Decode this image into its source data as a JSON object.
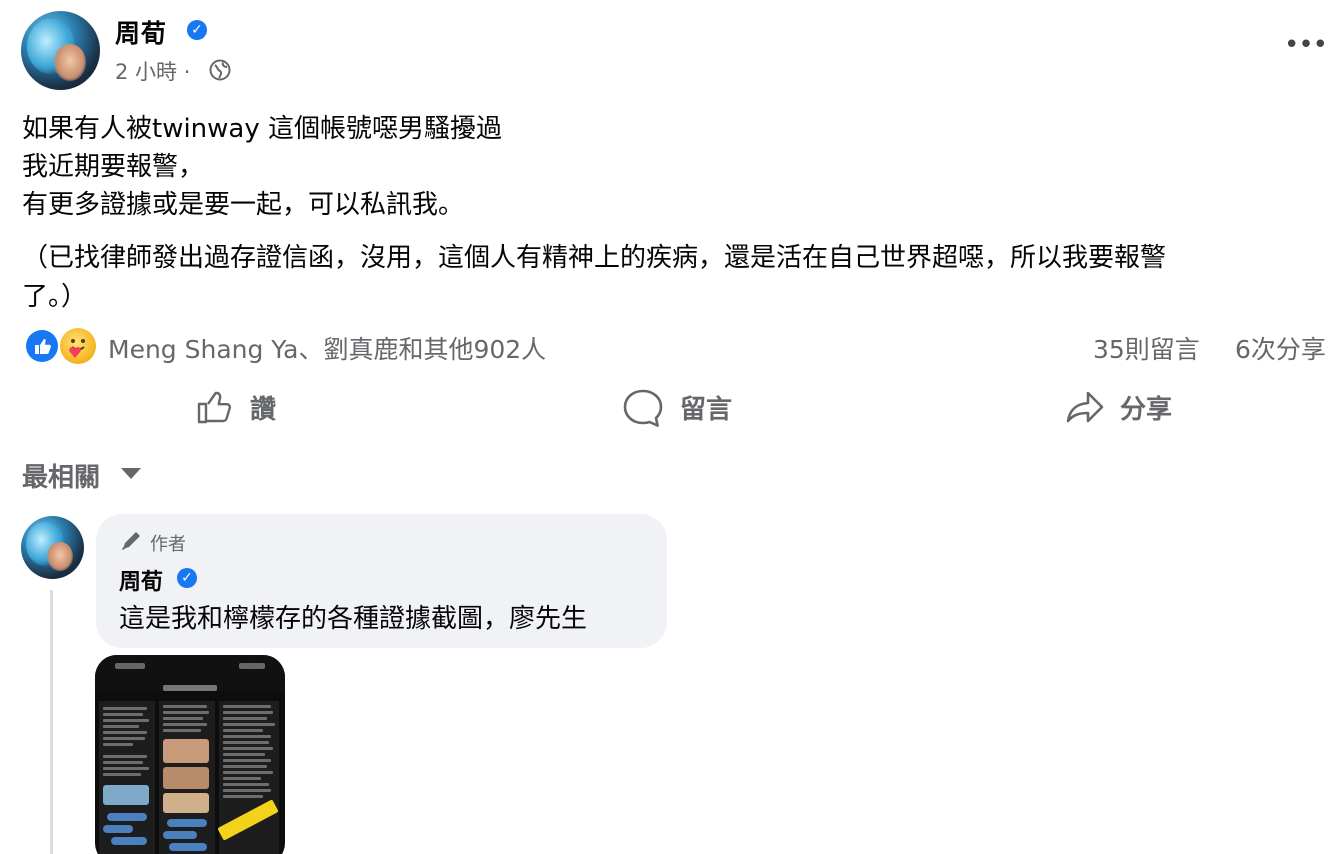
{
  "post": {
    "author": "周荀",
    "time": "2 小時 ·",
    "more": "•••",
    "lines": [
      "如果有人被twinway 這個帳號噁男騷擾過",
      "我近期要報警，",
      "有更多證據或是要一起，可以私訊我。",
      "（已找律師發出過存證信函，沒用，這個人有精神上的疾病，還是活在自己世界超噁，所以我要報警",
      "了。）"
    ]
  },
  "reactions": {
    "names": "Meng Shang Ya、劉真鹿和其他902人",
    "comments": "35則留言",
    "shares": "6次分享",
    "icons": [
      "like-reaction",
      "care-reaction"
    ]
  },
  "actions": {
    "like": "讚",
    "comment": "留言",
    "share": "分享"
  },
  "sort": {
    "label": "最相關"
  },
  "comment": {
    "badge": "作者",
    "author": "周荀",
    "text": "這是我和檸檬存的各種證據截圖，廖先生"
  },
  "colors": {
    "accent": "#1877f2",
    "secondary_text": "#65676b",
    "bubble": "#f0f2f5"
  }
}
